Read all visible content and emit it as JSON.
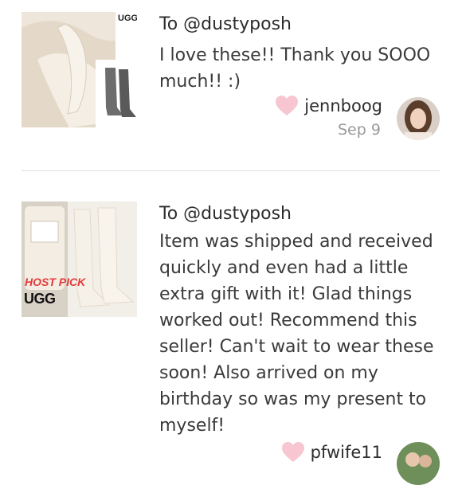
{
  "reviews": [
    {
      "to": "To @dustyposh",
      "message": "I love these!! Thank you SOOO much!! :)",
      "username": "jennboog",
      "date": "Sep 9",
      "thumb_brand": "UGG"
    },
    {
      "to": "To @dustyposh",
      "message_lines": [
        "Item was shipped and received",
        "quickly and even had a little",
        "extra gift with it! Glad things",
        "worked out! Recommend this",
        "seller! Can't wait to wear these",
        "soon! Also arrived on my",
        "birthday so was my present to",
        "myself!"
      ],
      "username": "pfwife11",
      "thumb_brand": "UGG",
      "thumb_stamp": "HOST PICK"
    }
  ],
  "colors": {
    "heart": "#f7c6d0",
    "date": "#9a9a9a",
    "divider": "#dedede",
    "stamp": "#e23b3b"
  },
  "icons": {
    "like": "heart-icon"
  }
}
